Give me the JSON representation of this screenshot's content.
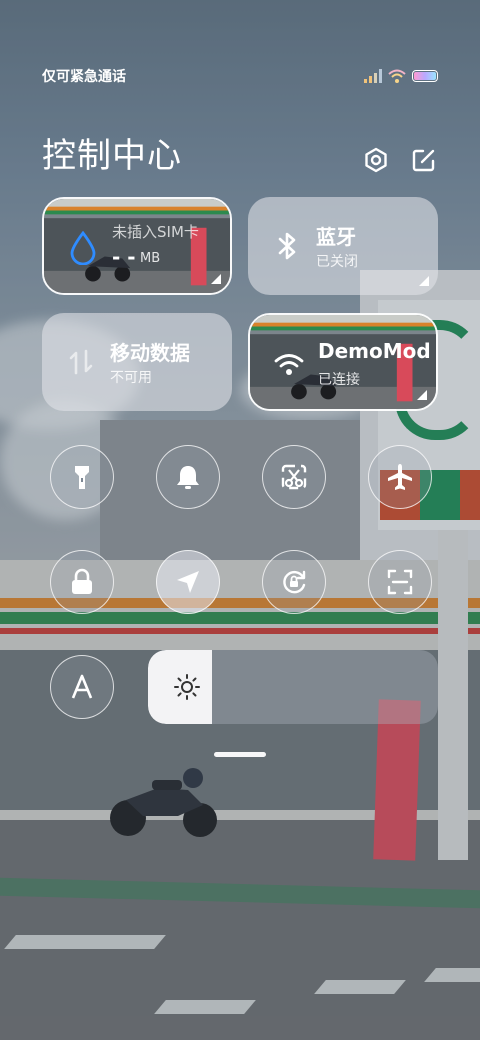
{
  "status_bar": {
    "carrier_text": "仅可紧急通话",
    "icons": [
      "signal-icon",
      "wifi-icon",
      "battery-icon"
    ]
  },
  "header": {
    "title": "控制中心",
    "settings_icon": "gear-icon",
    "edit_icon": "edit-icon"
  },
  "tiles": {
    "data_usage": {
      "title": "未插入SIM卡",
      "value": "- -",
      "unit": "MB",
      "icon": "droplet-icon"
    },
    "bluetooth": {
      "title": "蓝牙",
      "status": "已关闭",
      "icon": "bluetooth-icon"
    },
    "mobile_data": {
      "title": "移动数据",
      "status": "不可用",
      "icon": "mobile-data-icon"
    },
    "wifi": {
      "title": "DemoMod",
      "status": "已连接",
      "icon": "wifi-icon"
    }
  },
  "toggles": [
    {
      "name": "flashlight",
      "icon": "flashlight-icon",
      "active": false
    },
    {
      "name": "bell",
      "icon": "bell-icon",
      "active": false
    },
    {
      "name": "screenshot",
      "icon": "scissors-icon",
      "active": false
    },
    {
      "name": "airplane-mode",
      "icon": "airplane-icon",
      "active": false
    },
    {
      "name": "lock-screen",
      "icon": "lock-icon",
      "active": false
    },
    {
      "name": "location",
      "icon": "location-arrow-icon",
      "active": true
    },
    {
      "name": "rotation-lock",
      "icon": "rotation-lock-icon",
      "active": false
    },
    {
      "name": "scanner",
      "icon": "scan-icon",
      "active": false
    },
    {
      "name": "auto-brightness",
      "icon": "font-a-icon",
      "active": false
    }
  ],
  "brightness": {
    "level": 0.22,
    "icon": "sun-icon"
  },
  "colors": {
    "accent_blue": "#2f8cff",
    "tile_light": "#e1e4e8",
    "text": "#ffffff"
  }
}
